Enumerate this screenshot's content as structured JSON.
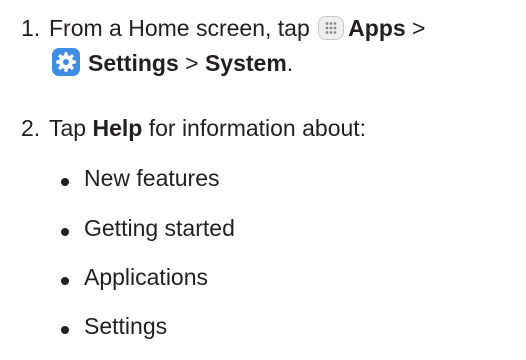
{
  "steps": [
    {
      "number": "1.",
      "line1_prefix": "From a Home screen, tap",
      "apps_icon": "apps-grid-icon",
      "apps_label": "Apps",
      "separator1": ">",
      "settings_icon": "settings-gear-icon",
      "settings_label": "Settings",
      "separator2": ">",
      "system_label": "System",
      "end_punct": "."
    },
    {
      "number": "2.",
      "prefix": "Tap",
      "help_label": "Help",
      "suffix": "for information about:"
    }
  ],
  "bullets": [
    "New features",
    "Getting started",
    "Applications",
    "Settings"
  ],
  "colors": {
    "text": "#231f20",
    "settings_icon_bg": "#3e8ee6",
    "apps_icon_bg": "#eeeeee"
  }
}
